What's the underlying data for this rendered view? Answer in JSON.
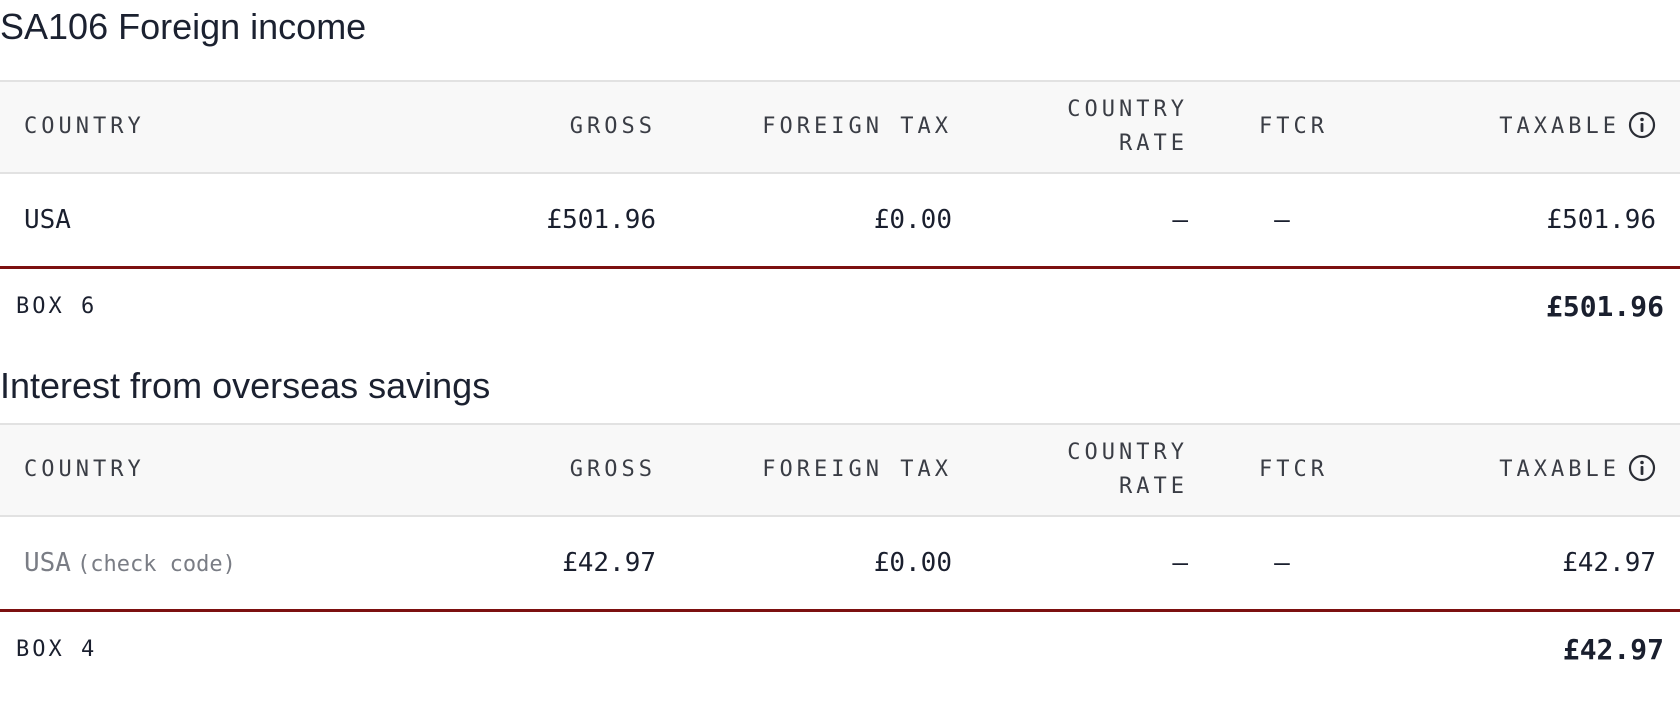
{
  "sections": [
    {
      "title": "SA106 Foreign income",
      "headers": [
        "COUNTRY",
        "GROSS",
        "FOREIGN TAX",
        "COUNTRY RATE",
        "FTCR",
        "TAXABLE"
      ],
      "row": {
        "country": "USA",
        "country_note": "",
        "gross": "£501.96",
        "foreign_tax": "£0.00",
        "country_rate": "—",
        "ftcr": "—",
        "taxable": "£501.96"
      },
      "total_label": "BOX 6",
      "total_value": "£501.96"
    },
    {
      "title": "Interest from overseas savings",
      "headers": [
        "COUNTRY",
        "GROSS",
        "FOREIGN TAX",
        "COUNTRY RATE",
        "FTCR",
        "TAXABLE"
      ],
      "row": {
        "country": "USA",
        "country_note": "(check code)",
        "gross": "£42.97",
        "foreign_tax": "£0.00",
        "country_rate": "—",
        "ftcr": "—",
        "taxable": "£42.97"
      },
      "total_label": "BOX 4",
      "total_value": "£42.97"
    }
  ],
  "icons": {
    "taxable_info": "info-circle-icon"
  },
  "colors": {
    "total_rule": "#7c1010",
    "header_bg": "#f8f8f8",
    "muted_text": "#7a7d85"
  }
}
